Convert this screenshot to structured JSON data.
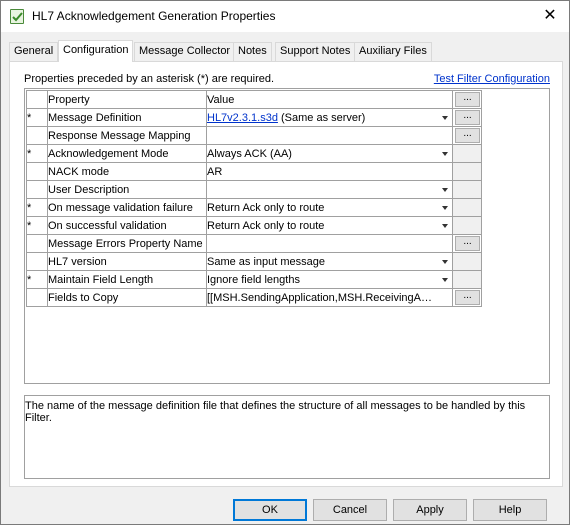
{
  "window": {
    "title": "HL7 Acknowledgement Generation Properties",
    "close_glyph": "✕"
  },
  "tabs": [
    {
      "label": "General"
    },
    {
      "label": "Configuration"
    },
    {
      "label": "Message Collector"
    },
    {
      "label": "Notes"
    },
    {
      "label": "Support Notes"
    },
    {
      "label": "Auxiliary Files"
    }
  ],
  "active_tab": "Configuration",
  "config": {
    "hint": "Properties preceded by an asterisk (*) are required.",
    "test_link": "Test Filter Configuration",
    "headers": {
      "property": "Property",
      "value": "Value",
      "button": "..."
    },
    "rows": [
      {
        "star": "*",
        "property": "Message Definition",
        "value": "HL7v2.3.1.s3d",
        "value_suffix": " (Same as server)",
        "dropdown": true,
        "button": "..."
      },
      {
        "star": "",
        "property": "Response Message Mapping",
        "value": "",
        "dropdown": false,
        "button": "..."
      },
      {
        "star": "*",
        "property": "Acknowledgement Mode",
        "value": "Always ACK (AA)",
        "dropdown": true,
        "button": ""
      },
      {
        "star": "",
        "property": "NACK mode",
        "value": "AR",
        "dropdown": false,
        "button": ""
      },
      {
        "star": "",
        "property": "User Description",
        "value": "",
        "dropdown": true,
        "button": ""
      },
      {
        "star": "*",
        "property": "On message validation failure",
        "value": "Return Ack only to route",
        "dropdown": true,
        "button": ""
      },
      {
        "star": "*",
        "property": "On successful validation",
        "value": "Return Ack only to route",
        "dropdown": true,
        "button": ""
      },
      {
        "star": "",
        "property": "Message Errors Property Name",
        "value": "",
        "dropdown": false,
        "button": "..."
      },
      {
        "star": "",
        "property": "HL7 version",
        "value": "Same as input message",
        "dropdown": true,
        "button": ""
      },
      {
        "star": "*",
        "property": "Maintain Field Length",
        "value": "Ignore field lengths",
        "dropdown": true,
        "button": ""
      },
      {
        "star": "",
        "property": "Fields to Copy",
        "value": "[[MSH.SendingApplication,MSH.ReceivingApplic...",
        "dropdown": false,
        "button": "..."
      }
    ],
    "description": "The name of the message definition file that defines the structure of all messages to be handled by this Filter."
  },
  "footer": {
    "ok": "OK",
    "cancel": "Cancel",
    "apply": "Apply",
    "help": "Help"
  }
}
